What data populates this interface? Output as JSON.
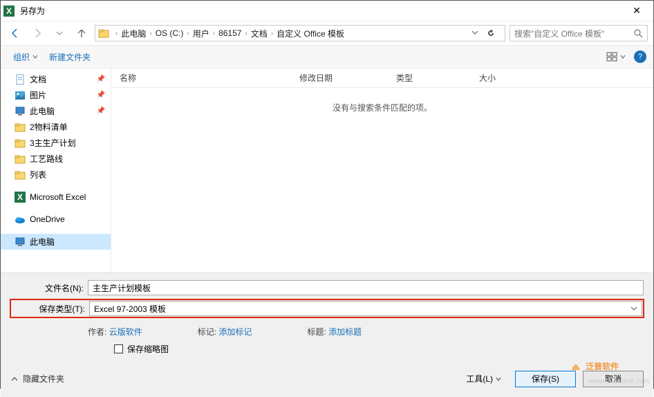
{
  "window": {
    "title": "另存为",
    "close": "✕"
  },
  "nav": {
    "breadcrumbs": [
      "此电脑",
      "OS (C:)",
      "用户",
      "86157",
      "文档",
      "自定义 Office 模板"
    ],
    "search_placeholder": "搜索\"自定义 Office 模板\""
  },
  "toolbar": {
    "organize": "组织",
    "new_folder": "新建文件夹"
  },
  "sidebar": {
    "items": [
      {
        "label": "文档",
        "icon": "doc",
        "pinned": true
      },
      {
        "label": "图片",
        "icon": "pic",
        "pinned": true
      },
      {
        "label": "此电脑",
        "icon": "pc",
        "pinned": true
      },
      {
        "label": "2物料清单",
        "icon": "folder"
      },
      {
        "label": "3主生产计划",
        "icon": "folder"
      },
      {
        "label": "工艺路线",
        "icon": "folder"
      },
      {
        "label": "列表",
        "icon": "folder"
      },
      {
        "label": "Microsoft Excel",
        "icon": "excel",
        "gap": true
      },
      {
        "label": "OneDrive",
        "icon": "onedrive",
        "gap": true
      },
      {
        "label": "此电脑",
        "icon": "pc",
        "gap": true,
        "selected": true
      }
    ]
  },
  "columns": {
    "name": "名称",
    "modified": "修改日期",
    "type": "类型",
    "size": "大小"
  },
  "empty_msg": "没有与搜索条件匹配的项。",
  "fields": {
    "filename_label": "文件名(N):",
    "filename_value": "主生产计划模板",
    "savetype_label": "保存类型(T):",
    "savetype_value": "Excel 97-2003 模板"
  },
  "meta": {
    "author_label": "作者:",
    "author_value": "云版软件",
    "tags_label": "标记:",
    "tags_value": "添加标记",
    "title_label": "标题:",
    "title_value": "添加标题",
    "thumb_label": "保存缩略图"
  },
  "footer": {
    "hide_folders": "隐藏文件夹",
    "tools": "工具(L)",
    "save": "保存(S)",
    "cancel": "取消"
  },
  "watermark": {
    "brand": "泛普软件",
    "url": "www.fanpusoft.com"
  }
}
